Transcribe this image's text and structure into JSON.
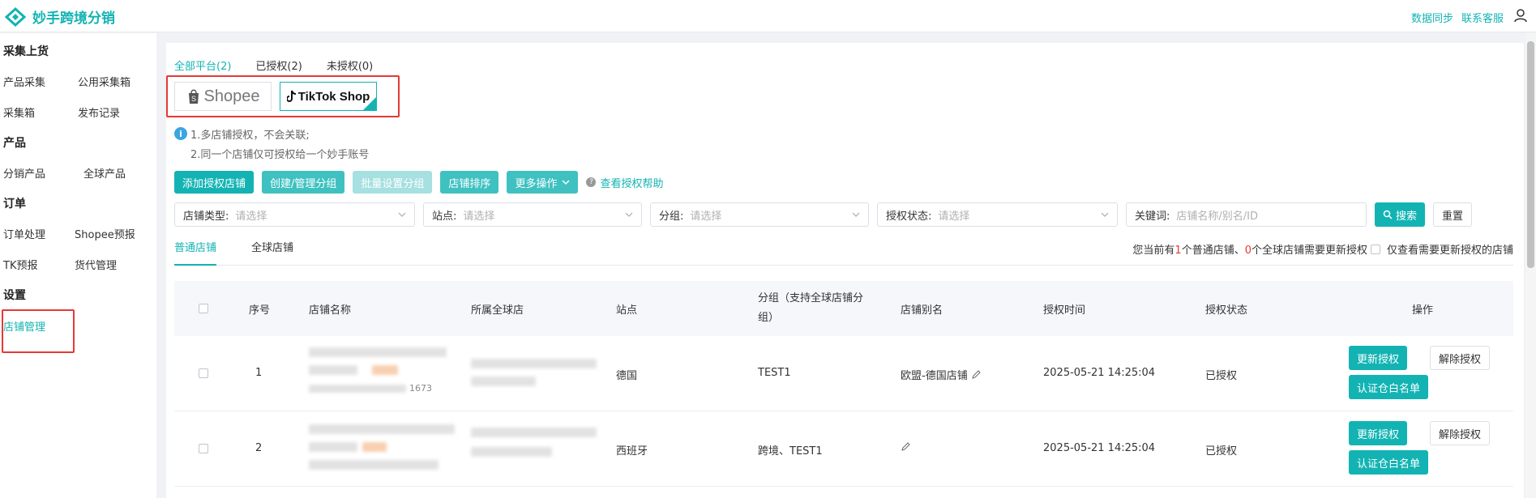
{
  "app": {
    "title": "妙手跨境分销"
  },
  "header": {
    "links": [
      "数据同步",
      "联系客服"
    ]
  },
  "sidebar": {
    "groups": [
      {
        "title": "采集上货",
        "items": [
          "产品采集",
          "公用采集箱",
          "采集箱",
          "发布记录"
        ]
      },
      {
        "title": "产品",
        "items": [
          "分销产品",
          "全球产品"
        ]
      },
      {
        "title": "订单",
        "items": [
          "订单处理",
          "Shopee预报",
          "TK预报",
          "货代管理"
        ]
      },
      {
        "title": "设置",
        "items": [
          "店铺管理"
        ]
      }
    ],
    "active": "店铺管理"
  },
  "platform_tabs": [
    "全部平台(2)",
    "已授权(2)",
    "未授权(0)"
  ],
  "platforms": [
    "Shopee",
    "TikTok Shop"
  ],
  "notes": [
    "1.多店铺授权，不会关联;",
    "2.同一个店铺仅可授权给一个妙手账号"
  ],
  "actions": {
    "add": "添加授权店铺",
    "group": "创建/管理分组",
    "batch": "批量设置分组",
    "sort": "店铺排序",
    "more": "更多操作",
    "help": "查看授权帮助"
  },
  "filters": [
    {
      "label": "店铺类型:",
      "placeholder": "请选择"
    },
    {
      "label": "站点:",
      "placeholder": "请选择"
    },
    {
      "label": "分组:",
      "placeholder": "请选择"
    },
    {
      "label": "授权状态:",
      "placeholder": "请选择"
    },
    {
      "label": "关键词:",
      "placeholder": "店铺名称/别名/ID"
    }
  ],
  "search": {
    "search_label": "搜索",
    "reset_label": "重置"
  },
  "store_tabs": [
    "普通店铺",
    "全球店铺"
  ],
  "status_note": {
    "prefix": "您当前有",
    "n1": "1",
    "mid": "个普通店铺、",
    "n2": "0",
    "suffix": "个全球店铺需要更新授权"
  },
  "only_need_label": "仅查看需要更新授权的店铺",
  "table": {
    "headers": [
      "序号",
      "店铺名称",
      "所属全球店",
      "站点",
      "分组（支持全球店铺分组）",
      "店铺别名",
      "授权时间",
      "授权状态",
      "操作"
    ],
    "rows": [
      {
        "index": "1",
        "name_tail": "1673",
        "site": "德国",
        "group": "TEST1",
        "alias": "欧盟-德国店铺",
        "time": "2025-05-21 14:25:04",
        "status": "已授权",
        "renew": "更新授权",
        "revoke": "解除授权",
        "whitelist": "认证仓白名单"
      },
      {
        "index": "2",
        "name_tail": "",
        "site": "西班牙",
        "group": "跨境、TEST1",
        "alias": "",
        "time": "2025-05-21 14:25:04",
        "status": "已授权",
        "renew": "更新授权",
        "revoke": "解除授权",
        "whitelist": "认证仓白名单"
      }
    ]
  },
  "colors": {
    "accent": "#13b3b3",
    "highlight_box": "#e53935"
  }
}
